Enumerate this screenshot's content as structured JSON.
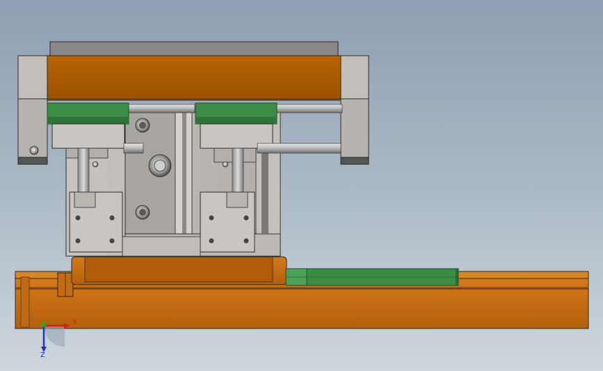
{
  "viewport": {
    "background_top": "#8d9fb2",
    "background_bottom": "#cdd6dc"
  },
  "colors": {
    "orange_body": "#a85b00",
    "orange_base": "#c56a10",
    "orange_edge": "#7a3d00",
    "green_rail": "#3a8a45",
    "green_rail_dark": "#1f5e29",
    "gray_plate": "#b9b6b2",
    "gray_light": "#d7d4cf",
    "gray_dark": "#6f6d6a",
    "outline": "#2a2a2a"
  },
  "triad": {
    "x_label": "X",
    "z_label": "Z",
    "x_color": "#d02020",
    "y_color": "#20b020",
    "z_color": "#2030c0"
  }
}
